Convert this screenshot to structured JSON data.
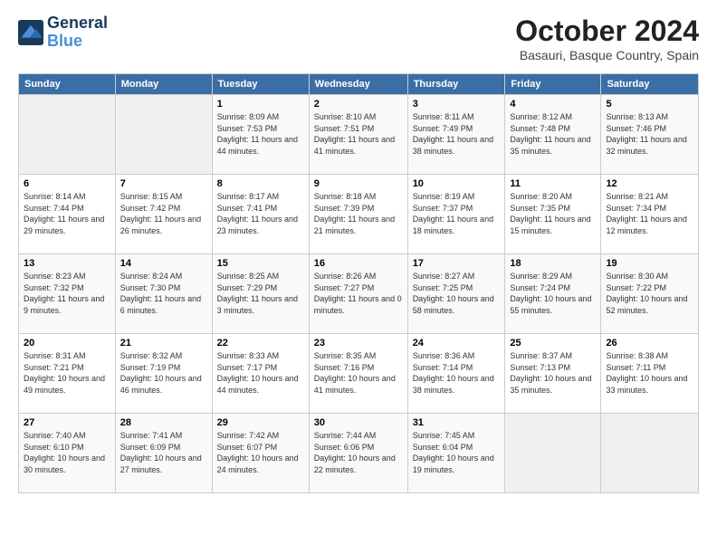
{
  "logo": {
    "line1": "General",
    "line2": "Blue"
  },
  "title": "October 2024",
  "location": "Basauri, Basque Country, Spain",
  "days_header": [
    "Sunday",
    "Monday",
    "Tuesday",
    "Wednesday",
    "Thursday",
    "Friday",
    "Saturday"
  ],
  "weeks": [
    [
      {
        "day": "",
        "sunrise": "",
        "sunset": "",
        "daylight": ""
      },
      {
        "day": "",
        "sunrise": "",
        "sunset": "",
        "daylight": ""
      },
      {
        "day": "1",
        "sunrise": "Sunrise: 8:09 AM",
        "sunset": "Sunset: 7:53 PM",
        "daylight": "Daylight: 11 hours and 44 minutes."
      },
      {
        "day": "2",
        "sunrise": "Sunrise: 8:10 AM",
        "sunset": "Sunset: 7:51 PM",
        "daylight": "Daylight: 11 hours and 41 minutes."
      },
      {
        "day": "3",
        "sunrise": "Sunrise: 8:11 AM",
        "sunset": "Sunset: 7:49 PM",
        "daylight": "Daylight: 11 hours and 38 minutes."
      },
      {
        "day": "4",
        "sunrise": "Sunrise: 8:12 AM",
        "sunset": "Sunset: 7:48 PM",
        "daylight": "Daylight: 11 hours and 35 minutes."
      },
      {
        "day": "5",
        "sunrise": "Sunrise: 8:13 AM",
        "sunset": "Sunset: 7:46 PM",
        "daylight": "Daylight: 11 hours and 32 minutes."
      }
    ],
    [
      {
        "day": "6",
        "sunrise": "Sunrise: 8:14 AM",
        "sunset": "Sunset: 7:44 PM",
        "daylight": "Daylight: 11 hours and 29 minutes."
      },
      {
        "day": "7",
        "sunrise": "Sunrise: 8:15 AM",
        "sunset": "Sunset: 7:42 PM",
        "daylight": "Daylight: 11 hours and 26 minutes."
      },
      {
        "day": "8",
        "sunrise": "Sunrise: 8:17 AM",
        "sunset": "Sunset: 7:41 PM",
        "daylight": "Daylight: 11 hours and 23 minutes."
      },
      {
        "day": "9",
        "sunrise": "Sunrise: 8:18 AM",
        "sunset": "Sunset: 7:39 PM",
        "daylight": "Daylight: 11 hours and 21 minutes."
      },
      {
        "day": "10",
        "sunrise": "Sunrise: 8:19 AM",
        "sunset": "Sunset: 7:37 PM",
        "daylight": "Daylight: 11 hours and 18 minutes."
      },
      {
        "day": "11",
        "sunrise": "Sunrise: 8:20 AM",
        "sunset": "Sunset: 7:35 PM",
        "daylight": "Daylight: 11 hours and 15 minutes."
      },
      {
        "day": "12",
        "sunrise": "Sunrise: 8:21 AM",
        "sunset": "Sunset: 7:34 PM",
        "daylight": "Daylight: 11 hours and 12 minutes."
      }
    ],
    [
      {
        "day": "13",
        "sunrise": "Sunrise: 8:23 AM",
        "sunset": "Sunset: 7:32 PM",
        "daylight": "Daylight: 11 hours and 9 minutes."
      },
      {
        "day": "14",
        "sunrise": "Sunrise: 8:24 AM",
        "sunset": "Sunset: 7:30 PM",
        "daylight": "Daylight: 11 hours and 6 minutes."
      },
      {
        "day": "15",
        "sunrise": "Sunrise: 8:25 AM",
        "sunset": "Sunset: 7:29 PM",
        "daylight": "Daylight: 11 hours and 3 minutes."
      },
      {
        "day": "16",
        "sunrise": "Sunrise: 8:26 AM",
        "sunset": "Sunset: 7:27 PM",
        "daylight": "Daylight: 11 hours and 0 minutes."
      },
      {
        "day": "17",
        "sunrise": "Sunrise: 8:27 AM",
        "sunset": "Sunset: 7:25 PM",
        "daylight": "Daylight: 10 hours and 58 minutes."
      },
      {
        "day": "18",
        "sunrise": "Sunrise: 8:29 AM",
        "sunset": "Sunset: 7:24 PM",
        "daylight": "Daylight: 10 hours and 55 minutes."
      },
      {
        "day": "19",
        "sunrise": "Sunrise: 8:30 AM",
        "sunset": "Sunset: 7:22 PM",
        "daylight": "Daylight: 10 hours and 52 minutes."
      }
    ],
    [
      {
        "day": "20",
        "sunrise": "Sunrise: 8:31 AM",
        "sunset": "Sunset: 7:21 PM",
        "daylight": "Daylight: 10 hours and 49 minutes."
      },
      {
        "day": "21",
        "sunrise": "Sunrise: 8:32 AM",
        "sunset": "Sunset: 7:19 PM",
        "daylight": "Daylight: 10 hours and 46 minutes."
      },
      {
        "day": "22",
        "sunrise": "Sunrise: 8:33 AM",
        "sunset": "Sunset: 7:17 PM",
        "daylight": "Daylight: 10 hours and 44 minutes."
      },
      {
        "day": "23",
        "sunrise": "Sunrise: 8:35 AM",
        "sunset": "Sunset: 7:16 PM",
        "daylight": "Daylight: 10 hours and 41 minutes."
      },
      {
        "day": "24",
        "sunrise": "Sunrise: 8:36 AM",
        "sunset": "Sunset: 7:14 PM",
        "daylight": "Daylight: 10 hours and 38 minutes."
      },
      {
        "day": "25",
        "sunrise": "Sunrise: 8:37 AM",
        "sunset": "Sunset: 7:13 PM",
        "daylight": "Daylight: 10 hours and 35 minutes."
      },
      {
        "day": "26",
        "sunrise": "Sunrise: 8:38 AM",
        "sunset": "Sunset: 7:11 PM",
        "daylight": "Daylight: 10 hours and 33 minutes."
      }
    ],
    [
      {
        "day": "27",
        "sunrise": "Sunrise: 7:40 AM",
        "sunset": "Sunset: 6:10 PM",
        "daylight": "Daylight: 10 hours and 30 minutes."
      },
      {
        "day": "28",
        "sunrise": "Sunrise: 7:41 AM",
        "sunset": "Sunset: 6:09 PM",
        "daylight": "Daylight: 10 hours and 27 minutes."
      },
      {
        "day": "29",
        "sunrise": "Sunrise: 7:42 AM",
        "sunset": "Sunset: 6:07 PM",
        "daylight": "Daylight: 10 hours and 24 minutes."
      },
      {
        "day": "30",
        "sunrise": "Sunrise: 7:44 AM",
        "sunset": "Sunset: 6:06 PM",
        "daylight": "Daylight: 10 hours and 22 minutes."
      },
      {
        "day": "31",
        "sunrise": "Sunrise: 7:45 AM",
        "sunset": "Sunset: 6:04 PM",
        "daylight": "Daylight: 10 hours and 19 minutes."
      },
      {
        "day": "",
        "sunrise": "",
        "sunset": "",
        "daylight": ""
      },
      {
        "day": "",
        "sunrise": "",
        "sunset": "",
        "daylight": ""
      }
    ]
  ]
}
